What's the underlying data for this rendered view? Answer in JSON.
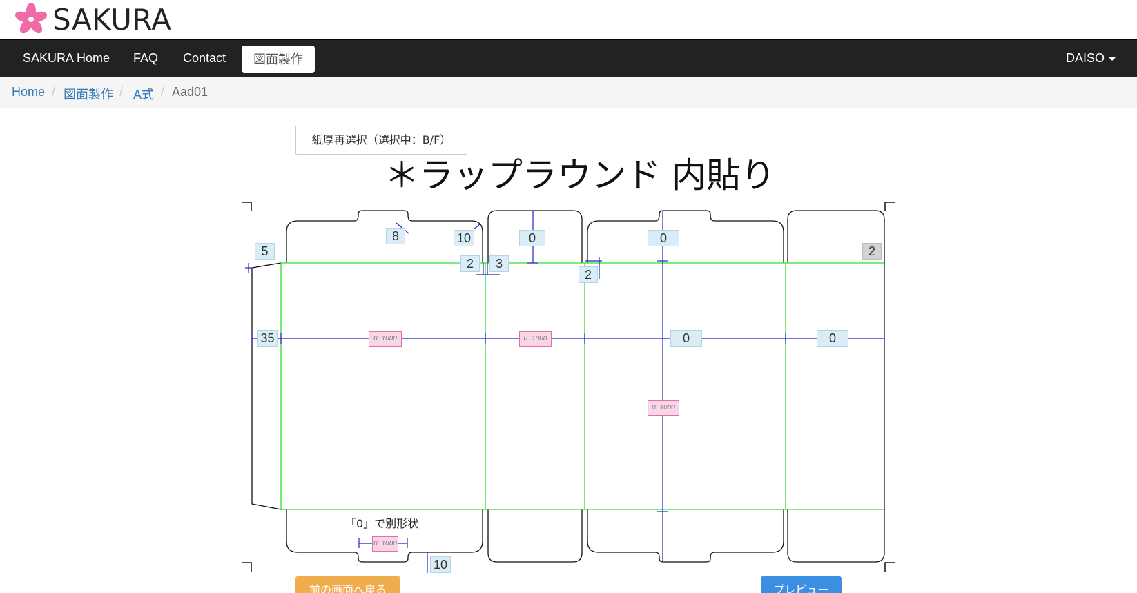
{
  "brand": {
    "name": "SAKURA"
  },
  "nav": {
    "items": [
      {
        "label": "SAKURA Home"
      },
      {
        "label": "FAQ"
      },
      {
        "label": "Contact"
      },
      {
        "label": "図面製作",
        "active": true
      }
    ],
    "user_menu": "DAISO"
  },
  "breadcrumb": {
    "items": [
      "Home",
      "図面製作",
      "A式"
    ],
    "current": "Aad01"
  },
  "reselect_button": "紙厚再選択（選択中：B/F）",
  "diagram": {
    "title": "＊ラップラウンド 内貼り",
    "dims": {
      "d5": "5",
      "d8": "8",
      "d10top": "10",
      "d0a": "0",
      "d0b": "0",
      "d2gray": "2",
      "d2a": "2",
      "d3": "3",
      "d2b": "2",
      "d35": "35",
      "d0c": "0",
      "d0d": "0",
      "d10bottom": "10"
    },
    "range_label": "0~1000",
    "note": "「0」で別形状"
  },
  "buttons": {
    "back": "前の画面へ戻る",
    "preview": "プレビュー"
  },
  "colors": {
    "fold_line": "#33dd33",
    "dimension_line": "#2222cc",
    "cut_line": "#111111"
  }
}
